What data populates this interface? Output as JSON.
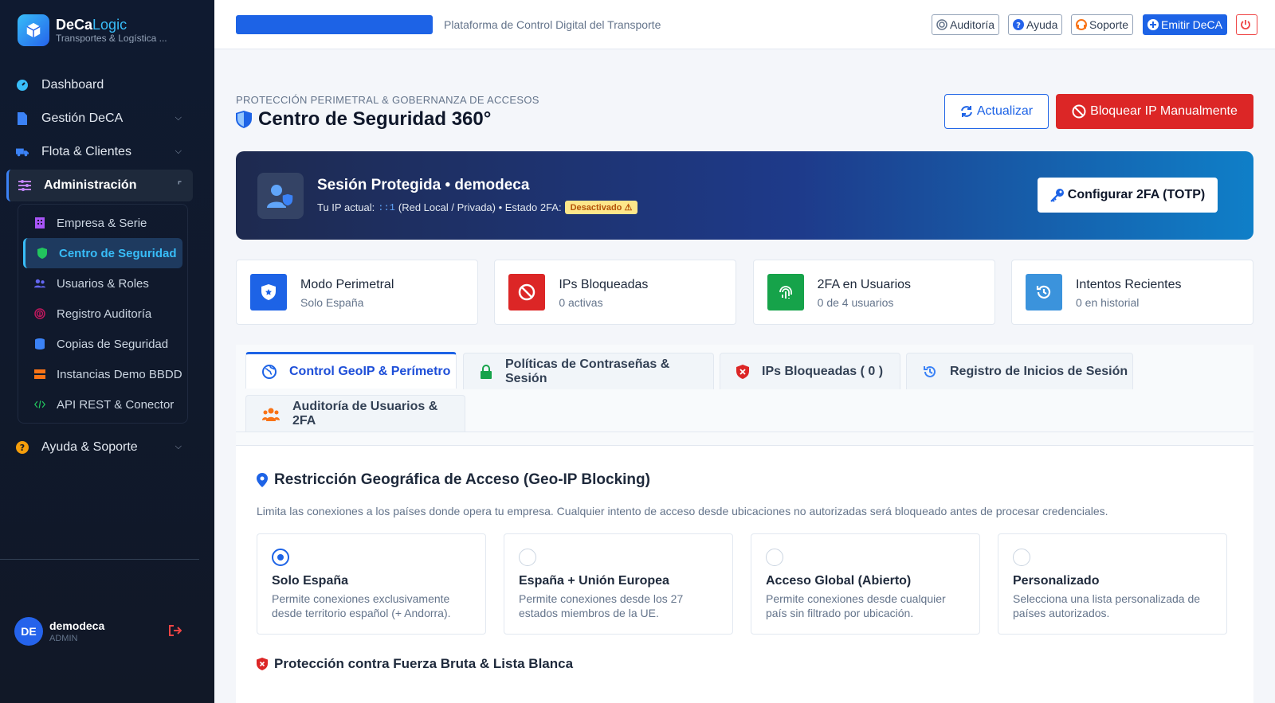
{
  "brand": {
    "name_a": "DeCa",
    "name_b": "Logic",
    "subtitle": "Transportes & Logística ..."
  },
  "sidebar": {
    "items": [
      {
        "label": "Dashboard"
      },
      {
        "label": "Gestión DeCA"
      },
      {
        "label": "Flota & Clientes"
      },
      {
        "label": "Administración"
      },
      {
        "label": "Ayuda & Soporte"
      }
    ],
    "submenu": [
      {
        "label": "Empresa & Serie"
      },
      {
        "label": "Centro de Seguridad"
      },
      {
        "label": "Usuarios & Roles"
      },
      {
        "label": "Registro Auditoría"
      },
      {
        "label": "Copias de Seguridad"
      },
      {
        "label": "Instancias Demo BBDD"
      },
      {
        "label": "API REST & Conector"
      }
    ],
    "user": {
      "initials": "DE",
      "name": "demodeca",
      "role": "ADMIN"
    }
  },
  "topbar": {
    "subtitle": "Plataforma de Control Digital del Transporte",
    "audit": "Auditoría",
    "help": "Ayuda",
    "support": "Soporte",
    "emit": "Emitir DeCA"
  },
  "page": {
    "kicker": "PROTECCIÓN PERIMETRAL & GOBERNANZA DE ACCESOS",
    "title": "Centro de Seguridad 360°",
    "refresh": "Actualizar",
    "block_ip": "Bloquear IP Manualmente"
  },
  "banner": {
    "title": "Sesión Protegida • demodeca",
    "ip_prefix": "Tu IP actual:",
    "ip": "::1",
    "ip_suffix": "(Red Local / Privada) • Estado 2FA:",
    "status": "Desactivado ⚠",
    "button": "Configurar 2FA (TOTP)"
  },
  "stats": [
    {
      "title": "Modo Perimetral",
      "sub": "Solo España"
    },
    {
      "title": "IPs Bloqueadas",
      "sub": "0 activas"
    },
    {
      "title": "2FA en Usuarios",
      "sub": "0 de 4 usuarios"
    },
    {
      "title": "Intentos Recientes",
      "sub": "0 en historial"
    }
  ],
  "tabs": [
    {
      "label": "Control GeoIP & Perímetro"
    },
    {
      "label": "Políticas de Contraseñas & Sesión"
    },
    {
      "label": "IPs Bloqueadas ( 0 )"
    },
    {
      "label": "Registro de Inicios de Sesión"
    },
    {
      "label": "Auditoría de Usuarios & 2FA"
    }
  ],
  "geo": {
    "title": "Restricción Geográfica de Acceso (Geo-IP Blocking)",
    "desc": "Limita las conexiones a los países donde opera tu empresa. Cualquier intento de acceso desde ubicaciones no autorizadas será bloqueado antes de procesar credenciales.",
    "options": [
      {
        "title": "Solo España",
        "desc": "Permite conexiones exclusivamente desde territorio español (+ Andorra).",
        "selected": true
      },
      {
        "title": "España + Unión Europea",
        "desc": "Permite conexiones desde los 27 estados miembros de la UE.",
        "selected": false
      },
      {
        "title": "Acceso Global (Abierto)",
        "desc": "Permite conexiones desde cualquier país sin filtrado por ubicación.",
        "selected": false
      },
      {
        "title": "Personalizado",
        "desc": "Selecciona una lista personalizada de países autorizados.",
        "selected": false
      }
    ]
  },
  "brute": {
    "title": "Protección contra Fuerza Bruta & Lista Blanca"
  }
}
